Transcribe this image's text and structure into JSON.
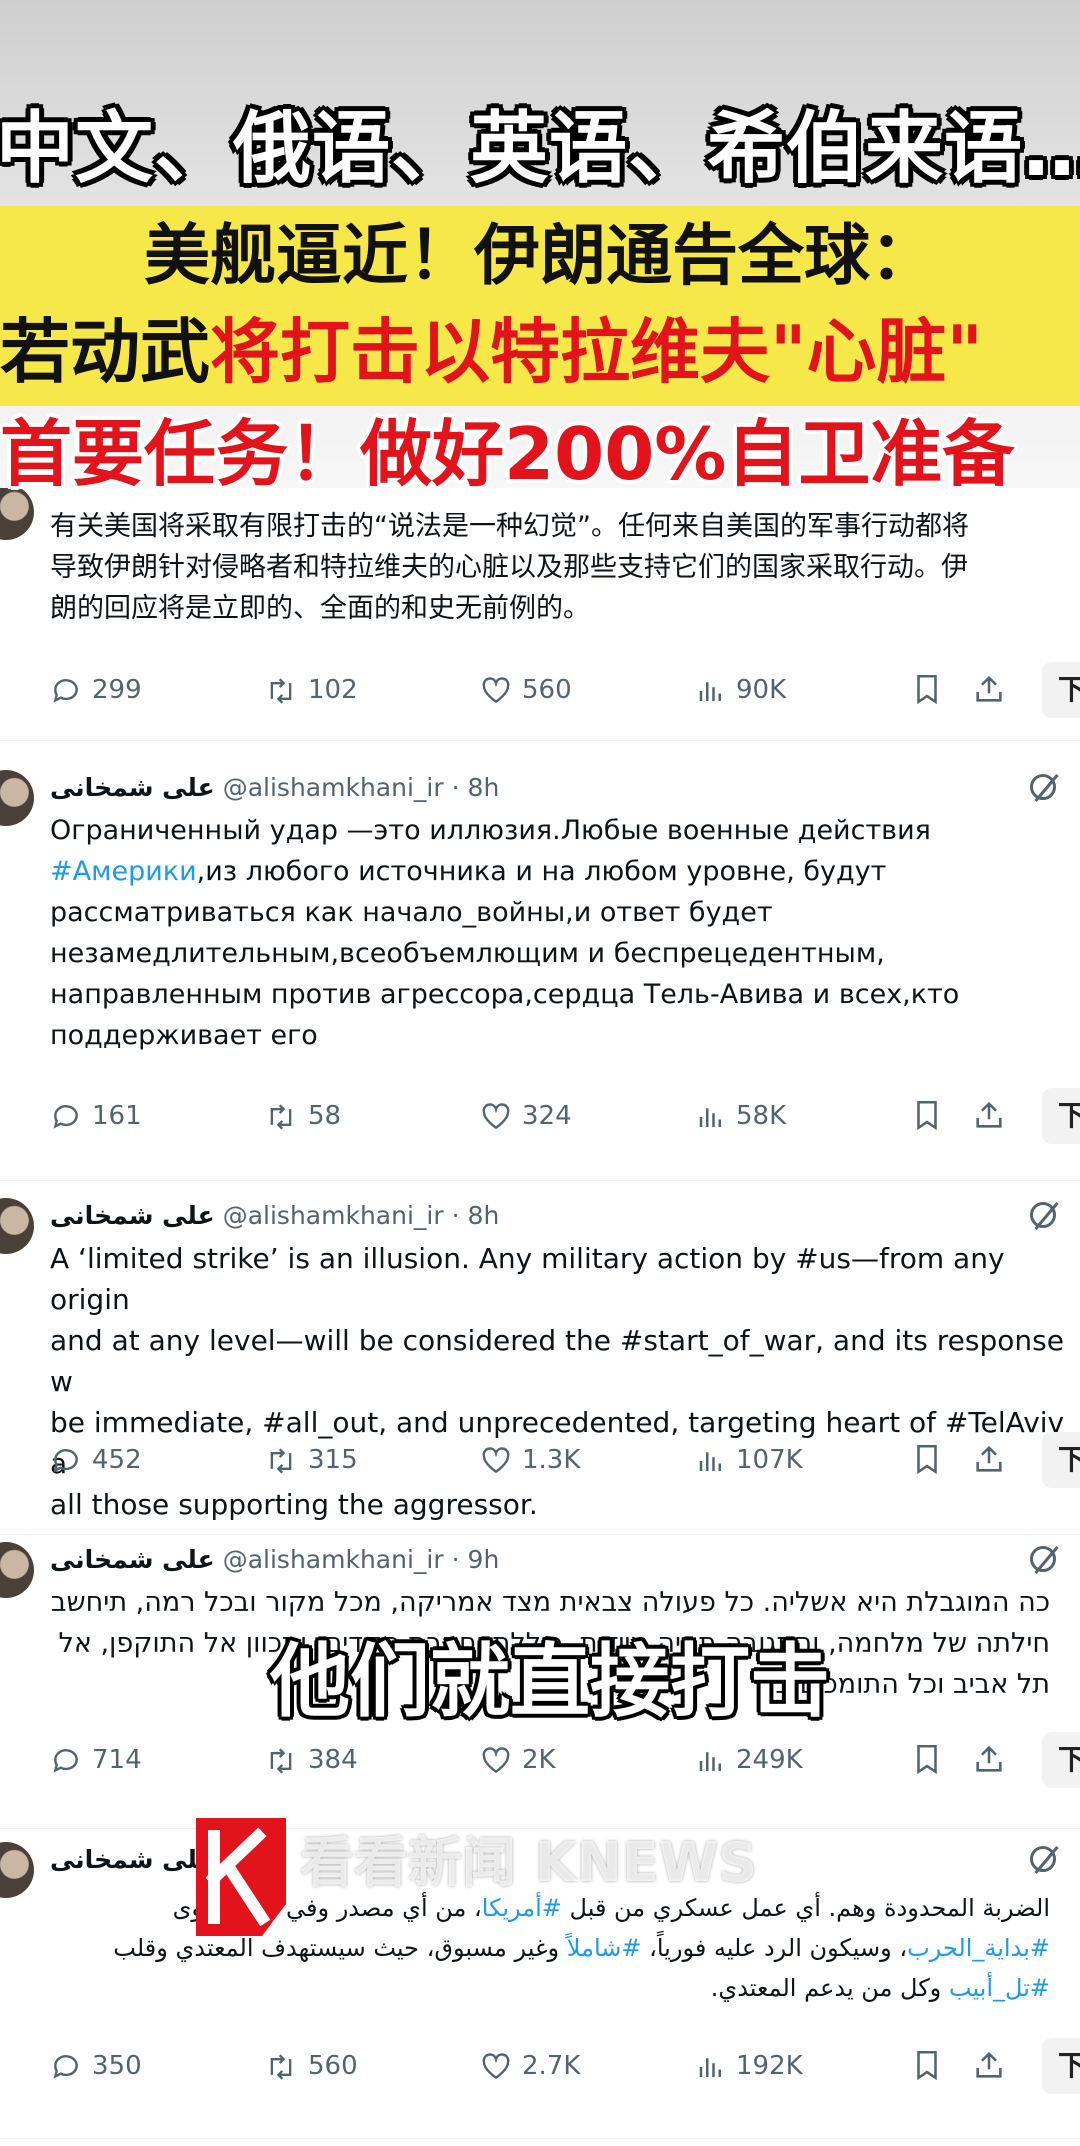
{
  "headline": {
    "line1": "中文、俄语、英语、希伯来语…",
    "line2": "美舰逼近！伊朗通告全球：",
    "line3_black": "若动武",
    "line3_red": "将打击以特拉维夫\"心脏\"",
    "line4": "首要任务！做好200%自卫准备"
  },
  "tweets": [
    {
      "author_name": "",
      "handle": "",
      "time": "",
      "body": "有关美国将采取有限打击的“说法是一种幻觉”。任何来自美国的军事行动都将\n导致伊朗针对侵略者和特拉维夫的心脏以及那些支持它们的国家采取行动。伊\n朗的回应将是立即的、全面的和史无前例的。",
      "replies": "299",
      "reposts": "102",
      "likes": "560",
      "views": "90K"
    },
    {
      "author_name": "علی شمخانی",
      "handle": "@alishamkhani_ir",
      "time": "· 8h",
      "body_parts": [
        "Ограниченный удар —это иллюзия.Любые военные действия\n",
        "#Америки",
        ",из любого источника и на любом уровне, будут\nрассматриваться как начало_войны,и ответ будет\nнезамедлительным,всеобъемлющим и беспрецедентным,\nнаправленным против агрессора,сердца Тель-Авива и всех,кто\nподдерживает его"
      ],
      "replies": "161",
      "reposts": "58",
      "likes": "324",
      "views": "58K"
    },
    {
      "author_name": "علی شمخانی",
      "handle": "@alishamkhani_ir",
      "time": "· 8h",
      "body": "A ‘limited strike’ is an illusion. Any military action by #us—from any origin\nand at any level—will be considered the #start_of_war, and its response w\nbe immediate, #all_out, and unprecedented, targeting heart of #TelAviv a\nall those supporting the aggressor.",
      "replies": "452",
      "reposts": "315",
      "likes": "1.3K",
      "views": "107K"
    },
    {
      "author_name": "علی شمخانی",
      "handle": "@alishamkhani_ir",
      "time": "· 9h",
      "body": "כה המוגבלת היא אשליה. כל פעולה צבאית מצד אמריקה, מכל מקור ובכל רמה, תיחשב\nחילתה של מלחמה, והתגובה תהיה מיידית, כוללת וחסרת תקדים, ותכוון אל התוקפן, אל\nתל אביב וכל התומכים בו",
      "replies": "714",
      "reposts": "384",
      "likes": "2K",
      "views": "249K"
    },
    {
      "author_name": "علی شمخانی",
      "handle": "@",
      "time": "",
      "body_parts": [
        "الضربة المحدودة وهم. أي عمل عسكري من قبل ",
        "#أمريكا",
        "، من أي مصدر وفي أي مستوى\n",
        "#بداية_الحرب",
        "، وسيكون الرد عليه فورياً، ",
        "#شاملاً",
        " وغير مسبوق، حيث سيستهدف المعتدي وقلب\n",
        "#تل_أبيب",
        " وكل من يدعم المعتدي."
      ],
      "replies": "350",
      "reposts": "560",
      "likes": "2.7K",
      "views": "192K"
    }
  ],
  "translate_label": "下",
  "subtitle": "他们就直接打击",
  "watermark": "看看新闻 KNEWS",
  "icons": {
    "reply": "reply-icon",
    "repost": "repost-icon",
    "like": "like-icon",
    "views": "views-icon",
    "bookmark": "bookmark-icon",
    "share": "share-icon",
    "grok": "grok-icon"
  },
  "colors": {
    "yellow_band": "#f7e84a",
    "red_text": "#e3131c",
    "link_blue": "#1d9bf0",
    "muted": "#536471"
  }
}
